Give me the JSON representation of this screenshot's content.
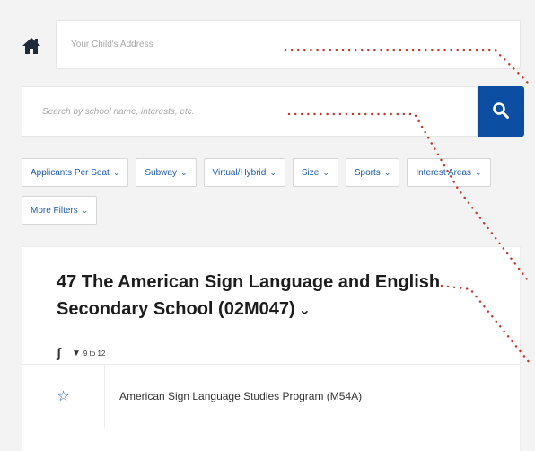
{
  "address": {
    "placeholder": "Your Child's Address"
  },
  "search": {
    "placeholder": "Search by school name, interests, etc."
  },
  "filters": [
    {
      "label": "Applicants Per Seat"
    },
    {
      "label": "Subway"
    },
    {
      "label": "Virtual/Hybrid"
    },
    {
      "label": "Size"
    },
    {
      "label": "Sports"
    },
    {
      "label": "Interest Areas"
    },
    {
      "label": "More Filters"
    }
  ],
  "school": {
    "title": "47 The American Sign Language and English Secondary School (02M047)",
    "access_symbol": "ʃ",
    "grades": "9 to 12",
    "program": "American Sign Language Studies Program (M54A)"
  },
  "colors": {
    "accent": "#0b4ea2",
    "link": "#1e5aa8",
    "annotation": "#c0392b"
  },
  "icons": [
    "home-icon",
    "search-icon",
    "chevron-down-icon",
    "accessibility-icon",
    "graduation-cap-icon",
    "star-icon"
  ]
}
